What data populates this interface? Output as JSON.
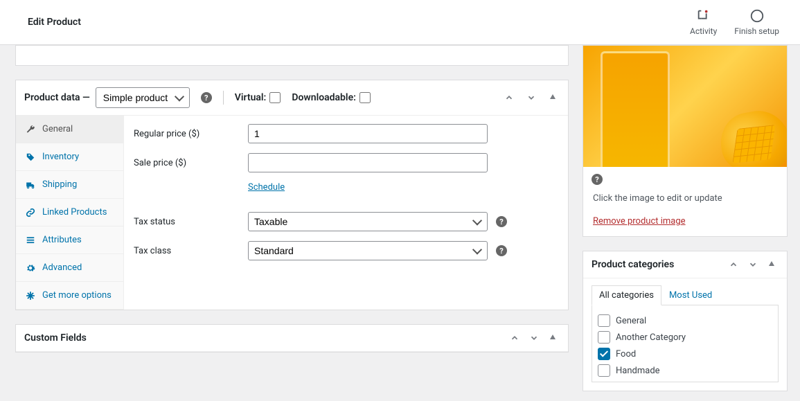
{
  "topbar": {
    "title": "Edit Product",
    "activity": "Activity",
    "finish_setup": "Finish setup"
  },
  "product_data": {
    "header_label": "Product data —",
    "type_selected": "Simple product",
    "virtual_label": "Virtual:",
    "virtual_checked": false,
    "downloadable_label": "Downloadable:",
    "downloadable_checked": false,
    "tabs": {
      "general": "General",
      "inventory": "Inventory",
      "shipping": "Shipping",
      "linked": "Linked Products",
      "attributes": "Attributes",
      "advanced": "Advanced",
      "more": "Get more options"
    },
    "fields": {
      "regular_price_label": "Regular price ($)",
      "regular_price_value": "1",
      "sale_price_label": "Sale price ($)",
      "sale_price_value": "",
      "schedule_link": "Schedule",
      "tax_status_label": "Tax status",
      "tax_status_value": "Taxable",
      "tax_class_label": "Tax class",
      "tax_class_value": "Standard"
    }
  },
  "custom_fields": {
    "title": "Custom Fields"
  },
  "product_image": {
    "caption": "Click the image to edit or update",
    "remove_link": "Remove product image"
  },
  "categories": {
    "title": "Product categories",
    "tab_all": "All categories",
    "tab_most_used": "Most Used",
    "items": [
      {
        "label": "General",
        "checked": false
      },
      {
        "label": "Another Category",
        "checked": false
      },
      {
        "label": "Food",
        "checked": true
      },
      {
        "label": "Handmade",
        "checked": false
      }
    ]
  }
}
